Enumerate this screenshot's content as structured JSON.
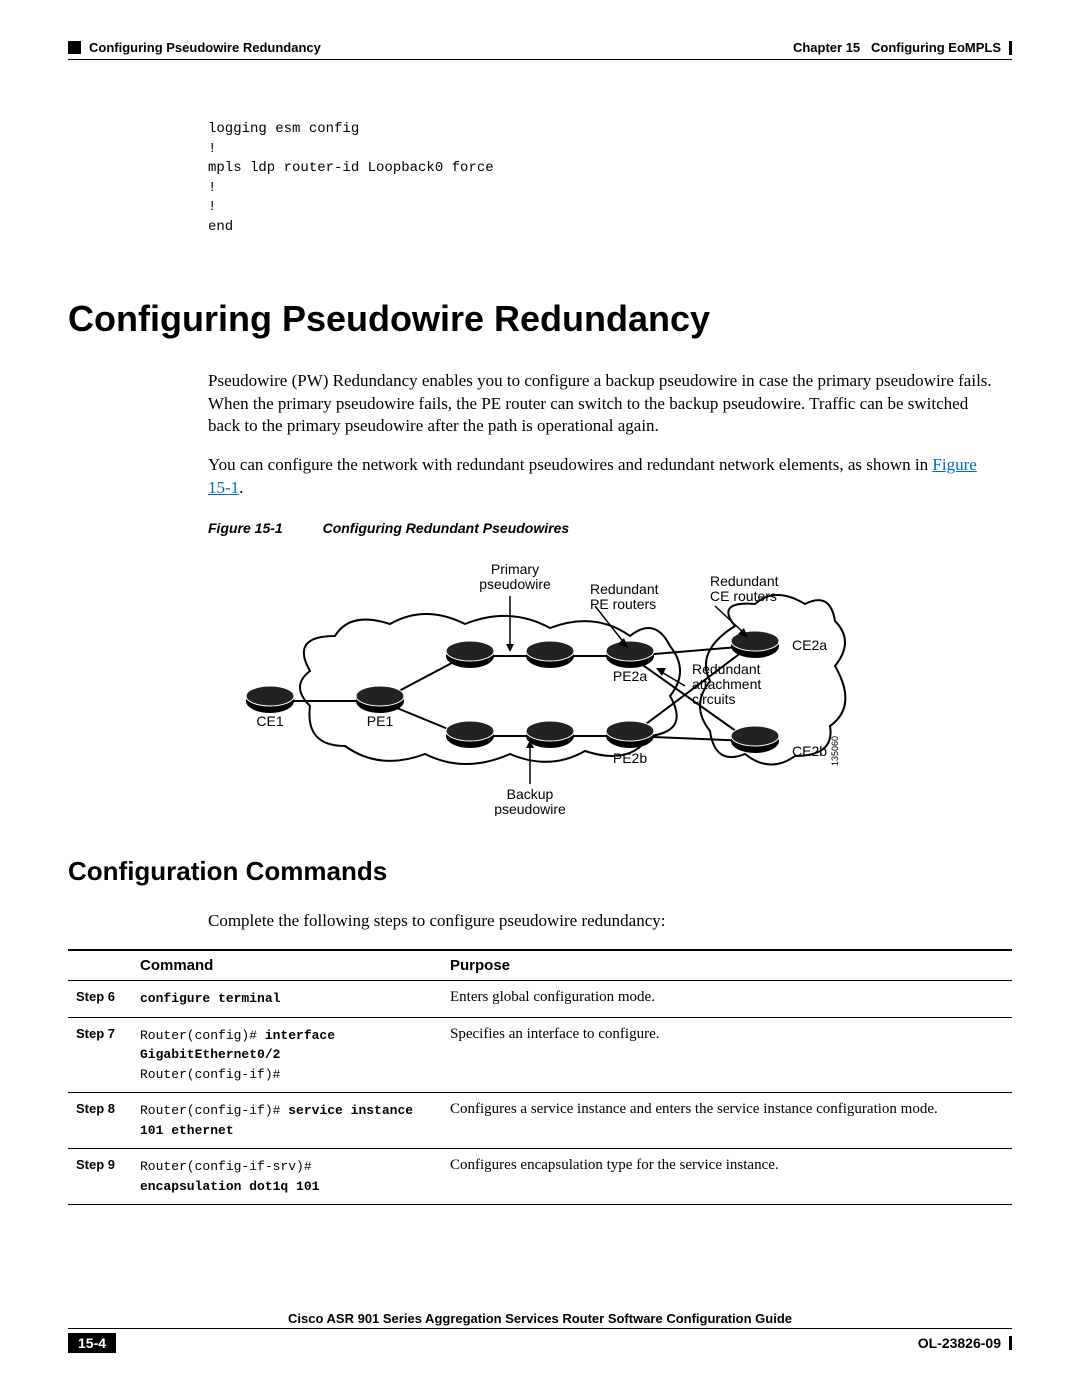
{
  "header": {
    "section_title": "Configuring Pseudowire Redundancy",
    "chapter_label": "Chapter 15",
    "chapter_title": "Configuring EoMPLS"
  },
  "config_block": "logging esm config\n!\nmpls ldp router-id Loopback0 force\n!\n!\nend",
  "h1": "Configuring Pseudowire Redundancy",
  "para1": "Pseudowire (PW) Redundancy enables you to configure a backup pseudowire in case the primary pseudowire fails. When the primary pseudowire fails, the PE router can switch to the backup pseudowire. Traffic can be switched back to the primary pseudowire after the path is operational again.",
  "para2_a": "You can configure the network with redundant pseudowires and redundant network elements, as shown in ",
  "para2_link": "Figure 15-1",
  "para2_b": ".",
  "figure": {
    "id": "Figure 15-1",
    "title": "Configuring Redundant Pseudowires",
    "labels": {
      "primary": "Primary\npseudowire",
      "redundant_pe": "Redundant\nPE routers",
      "redundant_ce": "Redundant\nCE routers",
      "redundant_attach": "Redundant\nattachment\ncircuits",
      "backup": "Backup\npseudowire",
      "ce1": "CE1",
      "pe1": "PE1",
      "pe2a": "PE2a",
      "pe2b": "PE2b",
      "ce2a": "CE2a",
      "ce2b": "CE2b",
      "ref": "135060"
    }
  },
  "h2": "Configuration Commands",
  "intro": "Complete the following steps to configure pseudowire redundancy:",
  "table": {
    "headers": {
      "step": "",
      "command": "Command",
      "purpose": "Purpose"
    },
    "rows": [
      {
        "step": "Step 6",
        "command_html": "<span class='b'>configure terminal</span>",
        "purpose": "Enters global configuration mode."
      },
      {
        "step": "Step 7",
        "command_html": "Router(config)# <span class='b'>interface\nGigabitEthernet0/2</span>\nRouter(config-if)#",
        "purpose": "Specifies an interface to configure."
      },
      {
        "step": "Step 8",
        "command_html": "Router(config-if)# <span class='b'>service instance\n101 ethernet</span>",
        "purpose": "Configures a service instance and enters the service instance configuration mode."
      },
      {
        "step": "Step 9",
        "command_html": "Router(config-if-srv)#\n<span class='b'>encapsulation dot1q 101</span>",
        "purpose": "Configures encapsulation type for the service instance."
      }
    ]
  },
  "footer": {
    "guide_title": "Cisco ASR 901 Series Aggregation Services Router Software Configuration Guide",
    "page_number": "15-4",
    "doc_id": "OL-23826-09"
  }
}
